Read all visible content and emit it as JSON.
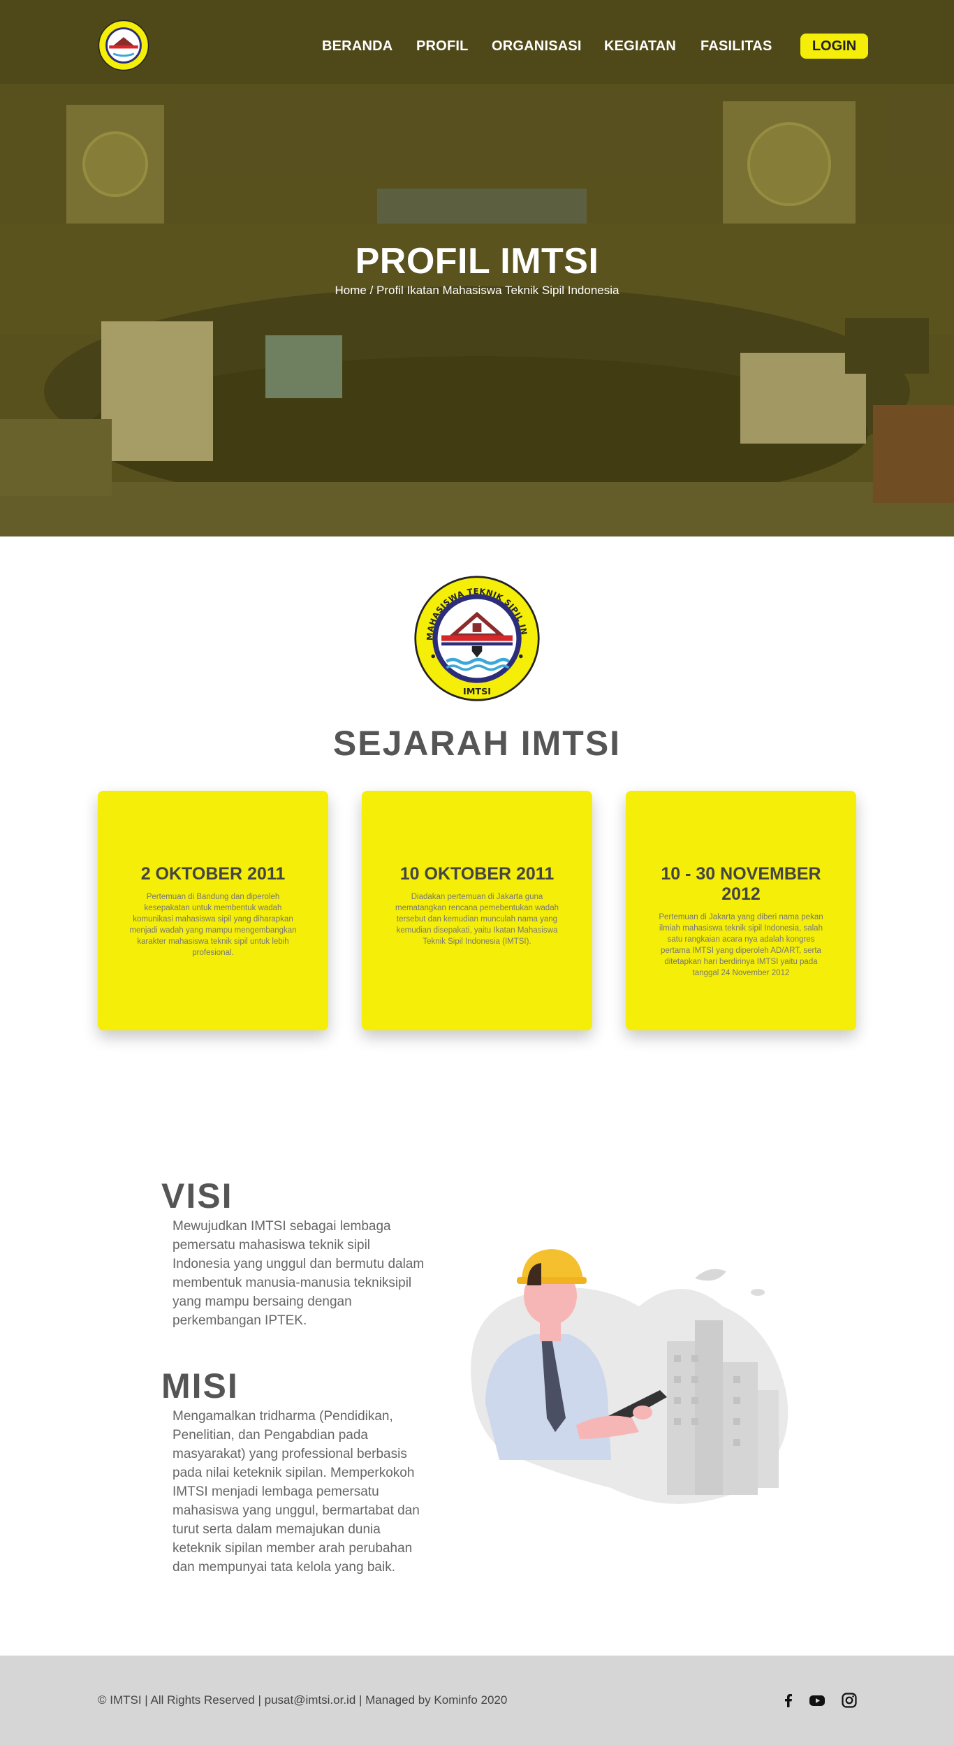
{
  "nav": {
    "items": [
      "BERANDA",
      "PROFIL",
      "ORGANISASI",
      "KEGIATAN",
      "FASILITAS"
    ],
    "login": "LOGIN"
  },
  "hero": {
    "title": "PROFIL IMTSI",
    "breadcrumb": "Home / Profil Ikatan Mahasiswa Teknik Sipil Indonesia"
  },
  "logo": {
    "ring_text": "IKATAN MAHASISWA TEKNIK SIPIL INDONESIA",
    "bottom_text": "IMTSI"
  },
  "sejarah": {
    "title": "SEJARAH IMTSI",
    "cards": [
      {
        "date": "2 OKTOBER 2011",
        "text": "Pertemuan di Bandung dan diperoleh kesepakatan untuk membentuk wadah komunikasi mahasiswa sipil yang diharapkan menjadi wadah yang mampu mengembangkan karakter mahasiswa teknik sipil untuk lebih profesional."
      },
      {
        "date": "10 OKTOBER 2011",
        "text": "Diadakan pertemuan di Jakarta guna mematangkan rencana pemebentukan wadah tersebut dan kemudian munculah nama yang kemudian disepakati, yaitu Ikatan Mahasiswa Teknik Sipil Indonesia  (IMTSI)."
      },
      {
        "date": "10 - 30 NOVEMBER 2012",
        "text": "Pertemuan di Jakarta yang diberi nama pekan ilmiah mahasiswa teknik sipil Indonesia, salah satu rangkaian acara nya adalah kongres pertama IMTSI yang diperoleh AD/ART, serta ditetapkan hari berdirinya IMTSI yaitu pada tanggal 24 November 2012"
      }
    ]
  },
  "visi": {
    "title": "VISI",
    "text": "Mewujudkan IMTSI sebagai lembaga pemersatu mahasiswa teknik sipil Indonesia yang unggul dan bermutu dalam membentuk manusia-manusia tekniksipil yang mampu bersaing dengan perkembangan IPTEK."
  },
  "misi": {
    "title": "MISI",
    "text": "Mengamalkan tridharma (Pendidikan, Penelitian, dan Pengabdian pada masyarakat) yang professional berbasis pada nilai keteknik sipilan. Memperkokoh IMTSI menjadi lembaga pemersatu mahasiswa yang unggul, bermartabat dan turut serta dalam memajukan dunia keteknik sipilan member arah perubahan dan mempunyai tata kelola yang baik."
  },
  "footer": {
    "text": "© IMTSI   |   All Rights Reserved   | pusat@imtsi.or.id   |   Managed by Kominfo 2020",
    "social": [
      "facebook-icon",
      "youtube-icon",
      "instagram-icon"
    ]
  },
  "colors": {
    "accent": "#f4ee08",
    "footer_bg": "#d6d6d6",
    "heading": "#555555"
  }
}
